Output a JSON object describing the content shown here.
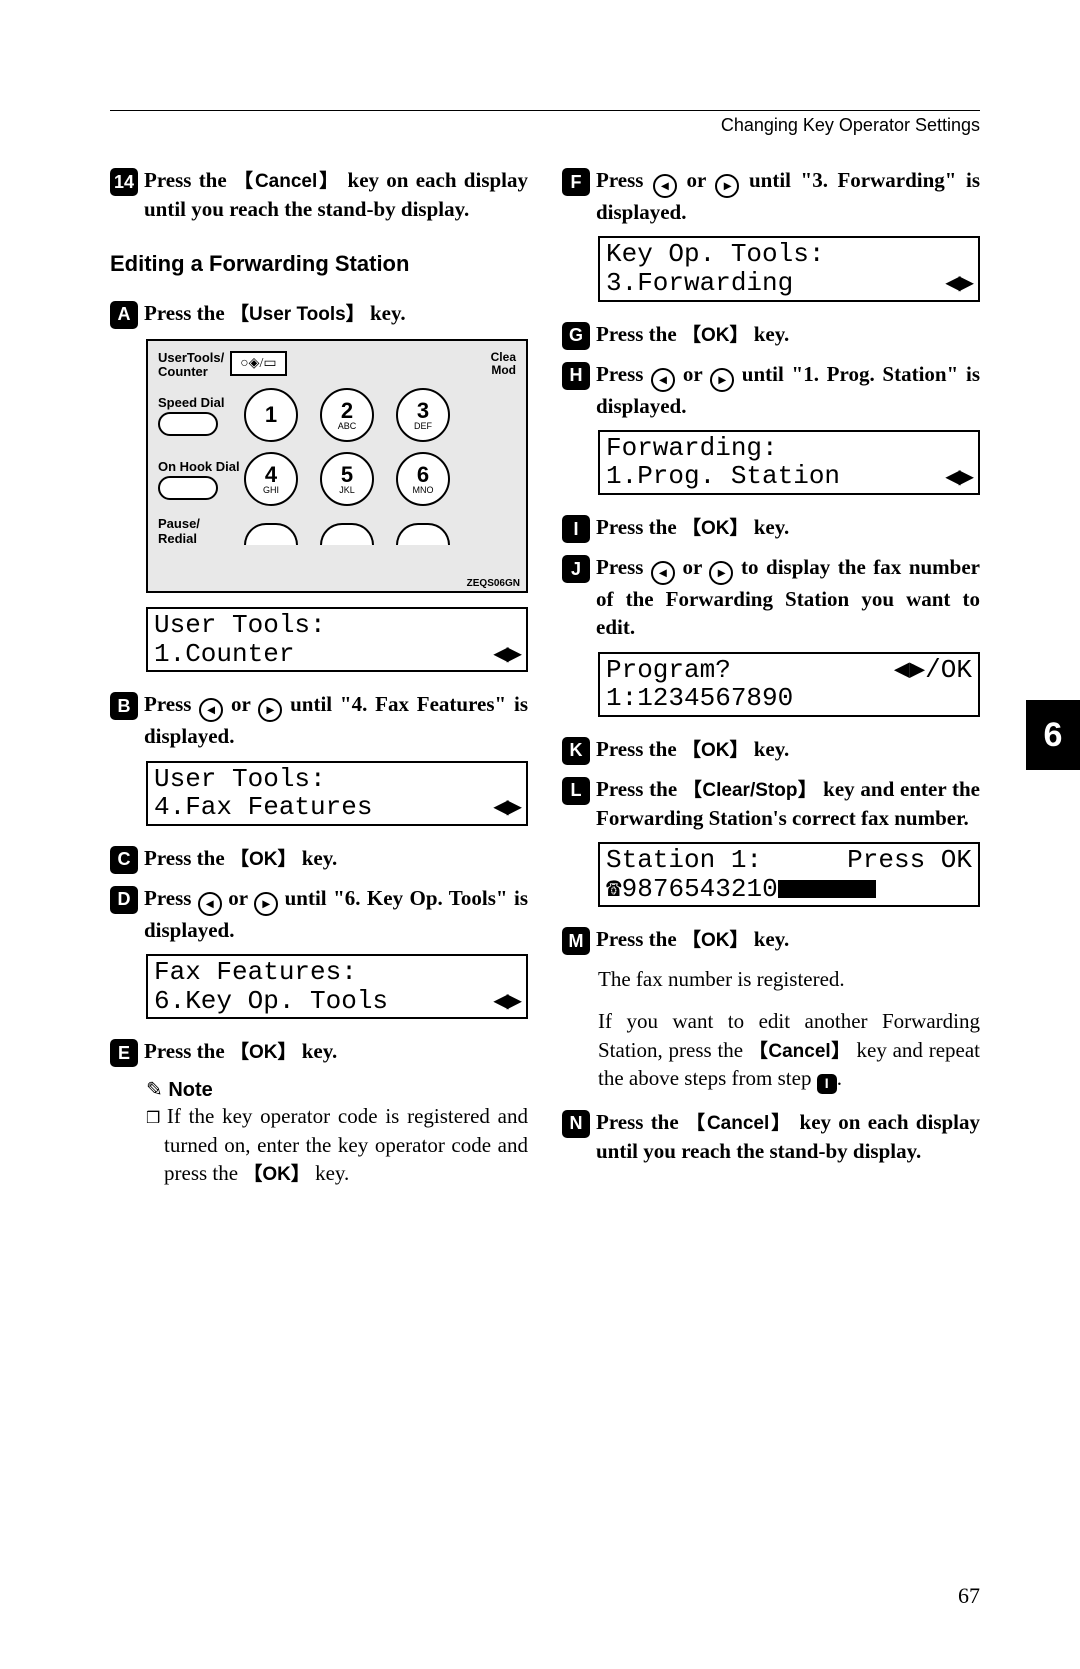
{
  "header": "Changing Key Operator Settings",
  "page_number": "67",
  "section_tab": "6",
  "left": {
    "step14": "Press the 【Cancel】 key on each display until you reach the stand-by display.",
    "subheading": "Editing a Forwarding Station",
    "stepA": "Press the 【User Tools】 key.",
    "keypad": {
      "label_usertools": "UserTools/\nCounter",
      "top_right": "Clea\nMod",
      "speed_dial": "Speed Dial",
      "on_hook": "On Hook Dial",
      "pause": "Pause/\nRedial",
      "code": "ZEQS06GN",
      "keys": [
        {
          "n": "1",
          "s": ""
        },
        {
          "n": "2",
          "s": "ABC"
        },
        {
          "n": "3",
          "s": "DEF"
        },
        {
          "n": "4",
          "s": "GHI"
        },
        {
          "n": "5",
          "s": "JKL"
        },
        {
          "n": "6",
          "s": "MNO"
        }
      ]
    },
    "lcd1": {
      "line1": "User Tools:",
      "line2": "1.Counter"
    },
    "stepB": "Press ◀ or ▶ until \"4. Fax Features\" is displayed.",
    "lcd2": {
      "line1": "User Tools:",
      "line2": "4.Fax Features"
    },
    "stepC": "Press the 【OK】 key.",
    "stepD": "Press ◀ or ▶ until \"6. Key Op. Tools\" is displayed.",
    "lcd3": {
      "line1": "Fax Features:",
      "line2": "6.Key Op. Tools"
    },
    "stepE": "Press the 【OK】 key.",
    "note_head": "Note",
    "note_body": "If the key operator code is registered and turned on, enter the key operator code and press the 【OK】 key."
  },
  "right": {
    "stepF": "Press ◀ or ▶ until \"3. Forwarding\" is displayed.",
    "lcd4": {
      "line1": "Key Op. Tools:",
      "line2": "3.Forwarding"
    },
    "stepG": "Press the 【OK】 key.",
    "stepH": "Press ◀ or ▶ until \"1. Prog. Station\" is displayed.",
    "lcd5": {
      "line1": "Forwarding:",
      "line2": "1.Prog. Station"
    },
    "stepI": "Press the 【OK】 key.",
    "stepJ": "Press ◀ or ▶ to display the fax number of the Forwarding Station you want to edit.",
    "lcd6": {
      "line1_l": "Program?",
      "line1_r": "◀▶/OK",
      "line2": "1:1234567890"
    },
    "stepK": "Press the 【OK】 key.",
    "stepL": "Press the 【Clear/Stop】 key and enter the Forwarding Station's correct fax number.",
    "lcd7": {
      "line1_l": "Station  1:",
      "line1_r": "Press OK",
      "line2_pre": "☎9876543210"
    },
    "stepM": "Press the 【OK】 key.",
    "body1": "The fax number is registered.",
    "body2": "If you want to edit another Forwarding Station, press the 【Cancel】 key and repeat the above steps from step I.",
    "stepN": "Press the 【Cancel】 key on each display until you reach the stand-by display."
  }
}
